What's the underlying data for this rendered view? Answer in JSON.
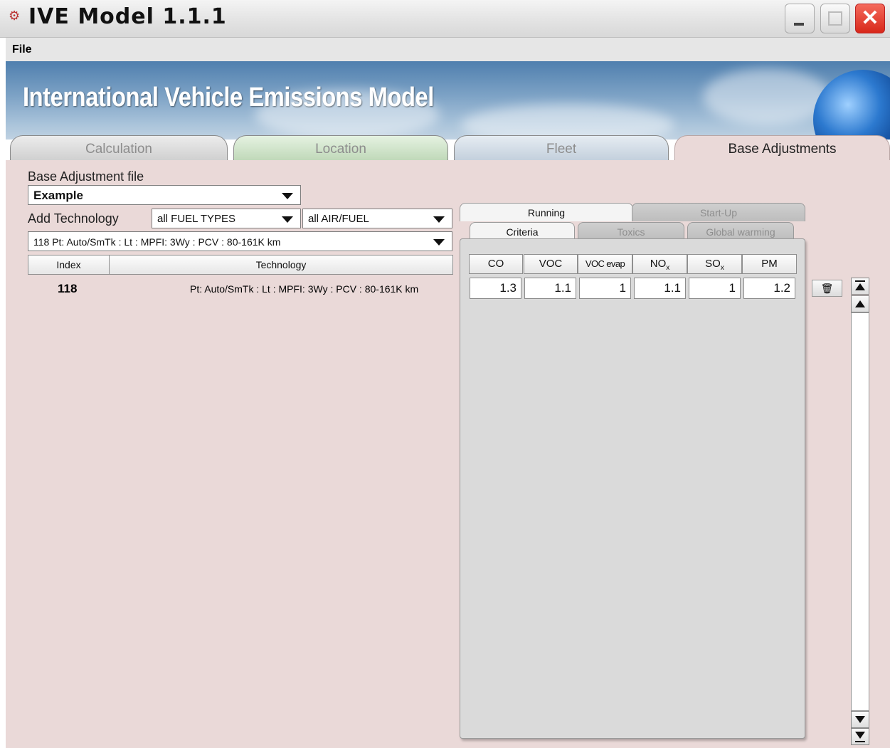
{
  "window": {
    "title": "IVE Model 1.1.1",
    "close_glyph": "✕"
  },
  "menu": {
    "file": "File"
  },
  "banner": {
    "title": "International Vehicle Emissions Model"
  },
  "main_tabs": [
    {
      "label": "Calculation"
    },
    {
      "label": "Location"
    },
    {
      "label": "Fleet"
    },
    {
      "label": "Base Adjustments"
    }
  ],
  "base_adjustment": {
    "file_label": "Base Adjustment file",
    "file_value": "Example",
    "add_technology_label": "Add Technology",
    "fuel_types_value": "all FUEL TYPES",
    "air_fuel_value": "all AIR/FUEL",
    "technology_value": "118   Pt: Auto/SmTk : Lt : MPFI: 3Wy : PCV : 80-161K km"
  },
  "table": {
    "headers": {
      "index": "Index",
      "technology": "Technology"
    },
    "rows": [
      {
        "index": "118",
        "technology": "Pt: Auto/SmTk : Lt : MPFI: 3Wy : PCV : 80-161K km"
      }
    ]
  },
  "right_panel": {
    "top_tabs": [
      {
        "label": "Running"
      },
      {
        "label": "Start-Up"
      }
    ],
    "sub_tabs": [
      {
        "label": "Criteria"
      },
      {
        "label": "Toxics"
      },
      {
        "label": "Global warming"
      }
    ],
    "columns": {
      "co": "CO",
      "voc": "VOC",
      "voc_evap": "VOC evap",
      "nox": "NO",
      "nox_sub": "x",
      "sox": "SO",
      "sox_sub": "x",
      "pm": "PM"
    },
    "values": {
      "co": "1.3",
      "voc": "1.1",
      "voc_evap": "1",
      "nox": "1.1",
      "sox": "1",
      "pm": "1.2"
    },
    "delete_glyph": "🗑"
  },
  "colors": {
    "panel_background": "#ead9d8",
    "tab_calculation": "#d9d9d9",
    "tab_location": "#cfe3c8",
    "tab_fleet": "#d0dae5",
    "tab_base_adjustments": "#ead9d8"
  }
}
